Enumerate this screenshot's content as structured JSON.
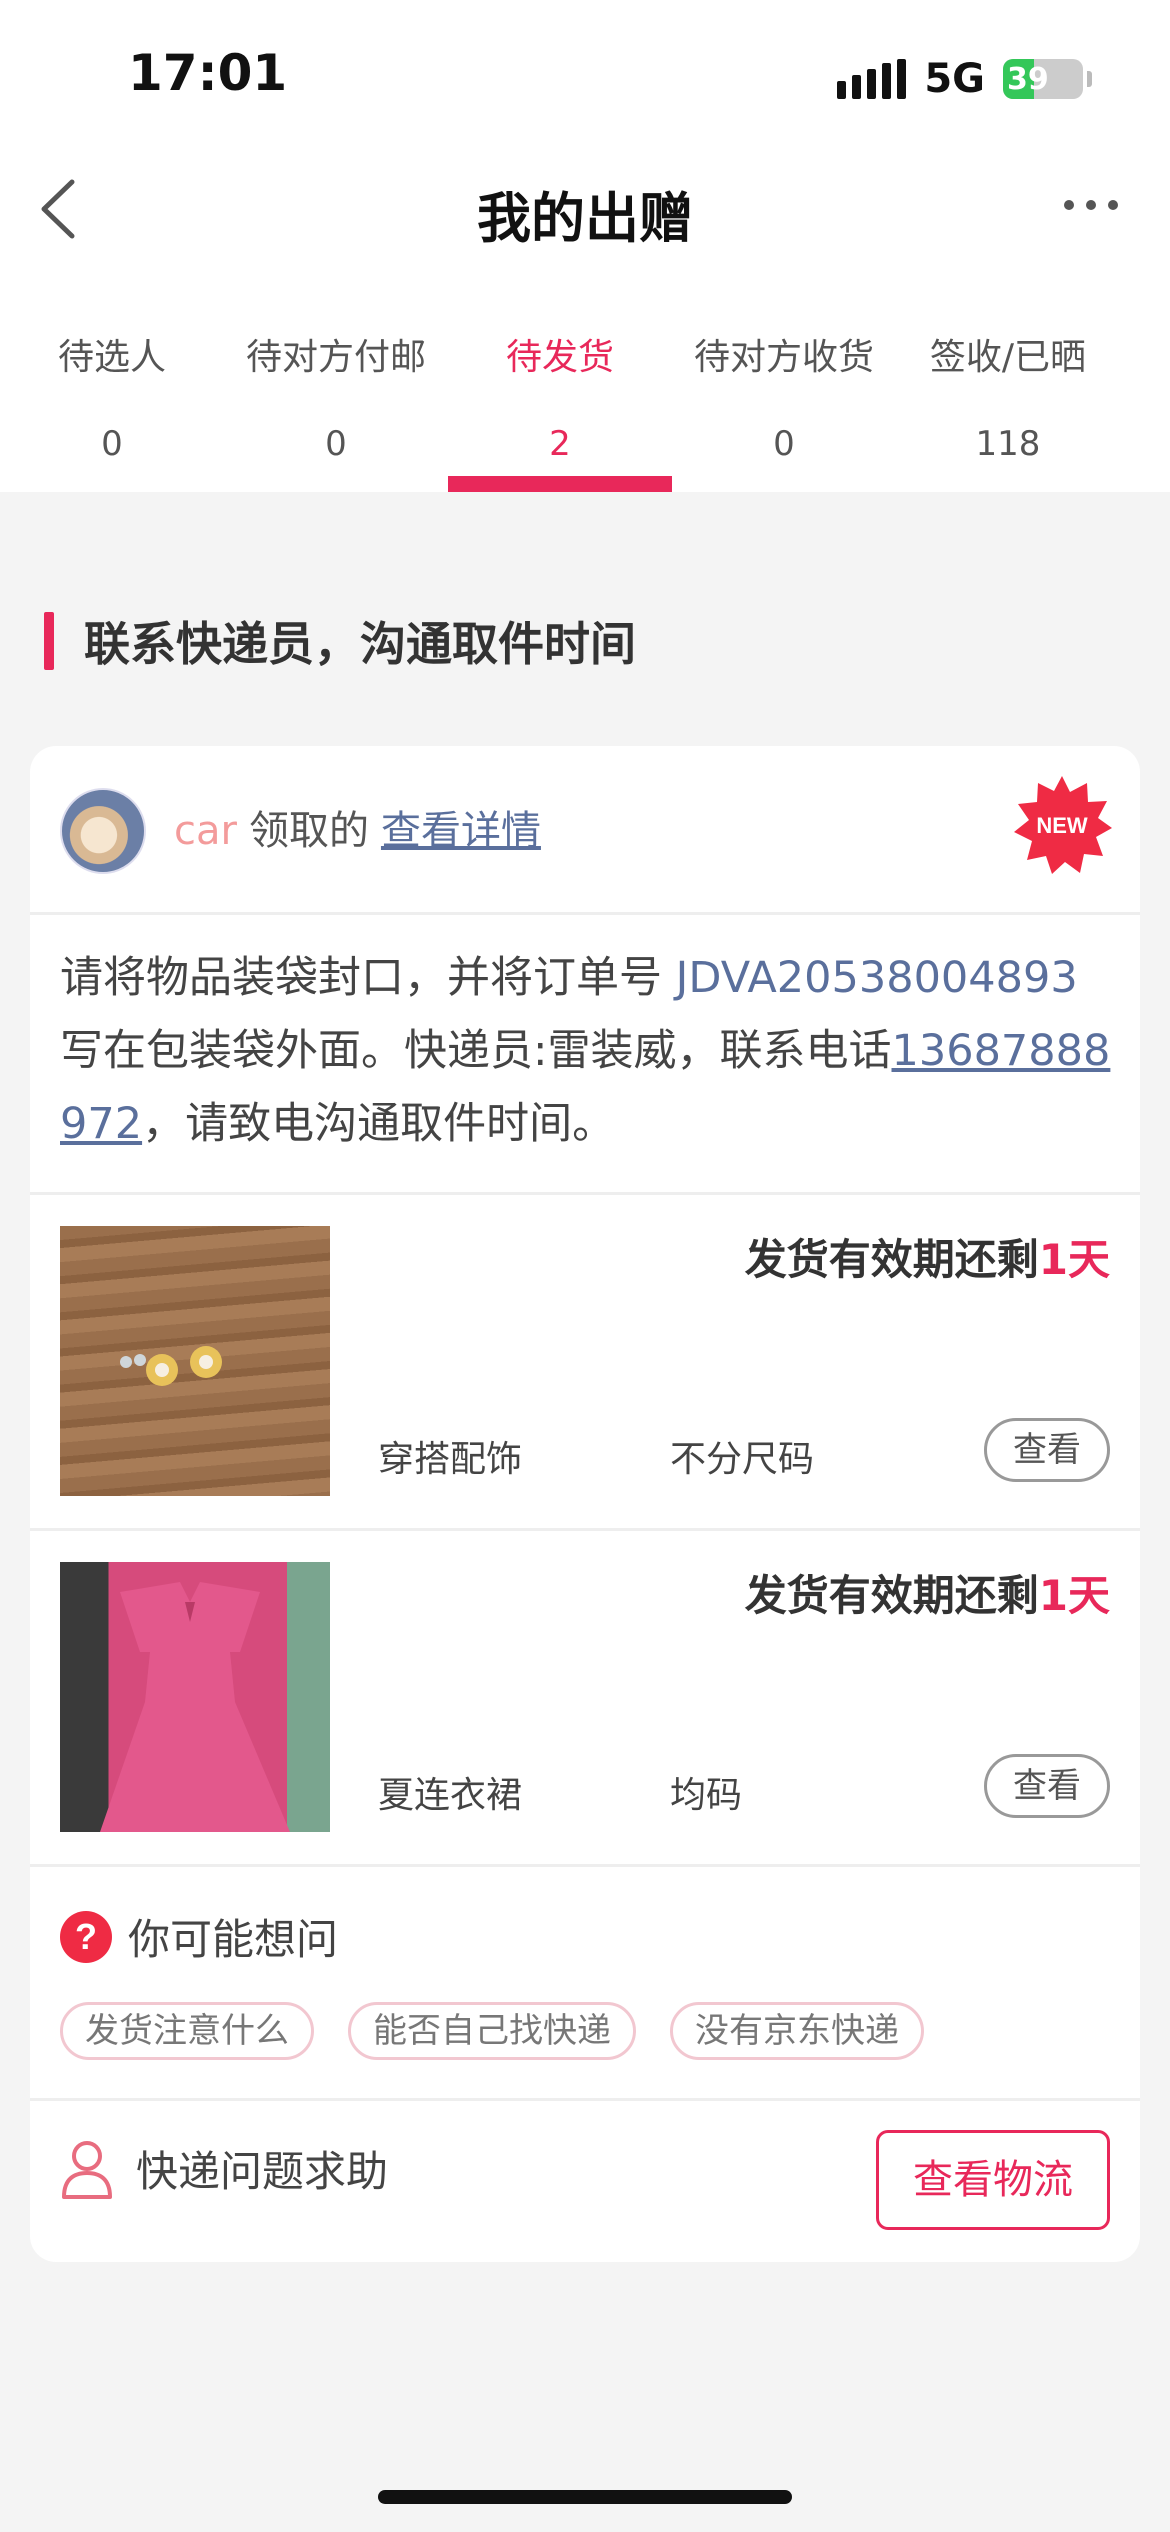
{
  "status_bar": {
    "time": "17:01",
    "network": "5G",
    "battery": "39",
    "battery_level": 0.39
  },
  "header": {
    "title": "我的出赠"
  },
  "tabs": [
    {
      "label": "待选人",
      "count": "0"
    },
    {
      "label": "待对方付邮",
      "count": "0"
    },
    {
      "label": "待发货",
      "count": "2",
      "active": true
    },
    {
      "label": "待对方收货",
      "count": "0"
    },
    {
      "label": "签收/已晒",
      "count": "118"
    }
  ],
  "section": {
    "title": "联系快递员，沟通取件时间"
  },
  "card": {
    "claimer": "car",
    "claim_text": "领取的",
    "detail_link": "查看详情",
    "badge": "NEW",
    "instruction": {
      "part1": "请将物品装袋封口，并将订单号 ",
      "order_no": "JDVA20538004893",
      "part2": " 写在包装袋外面。快递员:雷装威，联系电话",
      "phone": "13687888972",
      "part3": "，请致电沟通取件时间。"
    },
    "items": [
      {
        "deadline_prefix": "发货有效期还剩",
        "deadline_days": "1天",
        "category": "穿搭配饰",
        "size": "不分尺码",
        "view": "查看"
      },
      {
        "deadline_prefix": "发货有效期还剩",
        "deadline_days": "1天",
        "category": "夏连衣裙",
        "size": "均码",
        "view": "查看"
      }
    ],
    "faq": {
      "title": "你可能想问",
      "chips": [
        "发货注意什么",
        "能否自己找快递",
        "没有京东快递"
      ]
    },
    "help_text": "快递问题求助",
    "logistics_button": "查看物流"
  },
  "colors": {
    "accent": "#e8285a",
    "link": "#5a6f9c",
    "background": "#f4f4f4"
  }
}
